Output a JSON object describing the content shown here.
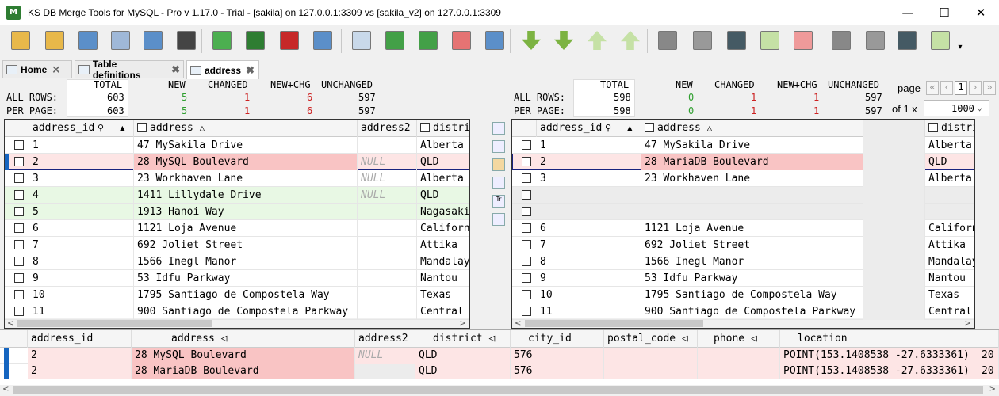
{
  "window": {
    "title": "KS DB Merge Tools for MySQL - Pro v 1.17.0 - Trial - [sakila] on 127.0.0.1:3309 vs [sakila_v2] on 127.0.0.1:3309",
    "minimize": "—",
    "maximize": "☐",
    "close": "✕"
  },
  "toolbar_icons": [
    "open-folder-icon",
    "open-folder-star-icon",
    "compare-tables-icon",
    "select-sql-icon",
    "table-settings-icon",
    "binoculars-icon",
    "refresh-icon",
    "export-excel-icon",
    "sql-script-icon",
    "copy-pages-icon",
    "grid-all-icon",
    "grid-green-icon",
    "grid-green2-icon",
    "grid-red-icon",
    "grid-blue-icon",
    "down-next-icon",
    "down-next2-icon",
    "up-prev-icon",
    "up-prev2-icon",
    "checklist-icon",
    "page-icon",
    "check-dark-icon",
    "merge-right-icon",
    "delete-right-icon",
    "checklist2-icon",
    "page2-icon",
    "check-dark2-icon",
    "merge-left-icon",
    "more-arrow-icon"
  ],
  "tabs": [
    {
      "label": "Home"
    },
    {
      "label": "Table definitions"
    },
    {
      "label": "address"
    }
  ],
  "stats": {
    "all_rows_label": "ALL ROWS:",
    "per_page_label": "PER PAGE:",
    "headers": {
      "total": "TOTAL",
      "new": "NEW",
      "changed": "CHANGED",
      "new_chg": "NEW+CHG",
      "unchanged": "UNCHANGED"
    },
    "left": {
      "all": {
        "total": "603",
        "new": "5",
        "changed": "1",
        "new_chg": "6",
        "unchanged": "597"
      },
      "page": {
        "total": "603",
        "new": "5",
        "changed": "1",
        "new_chg": "6",
        "unchanged": "597"
      }
    },
    "right": {
      "all": {
        "total": "598",
        "new": "0",
        "changed": "1",
        "new_chg": "1",
        "unchanged": "597"
      },
      "page": {
        "total": "598",
        "new": "0",
        "changed": "1",
        "new_chg": "1",
        "unchanged": "597"
      }
    },
    "colors": {
      "new": "#2e9e2e",
      "changed": "#cc2222"
    }
  },
  "paging": {
    "page_label": "page",
    "first": "«",
    "prev": "‹",
    "current": "1",
    "next": "›",
    "last": "»",
    "of_label": "of 1 x",
    "page_size": "1000",
    "dropdown": "⌄"
  },
  "left_grid": {
    "headers": {
      "id": "address_id",
      "address": "address",
      "address2": "address2",
      "district": "distric"
    },
    "sort_asc": "▲",
    "sort_hint": "△",
    "search_icon": "🔍",
    "rows": [
      {
        "id": "1",
        "address": "47 MySakila Drive",
        "address2": "",
        "district": "Alberta",
        "state": ""
      },
      {
        "id": "2",
        "address": "28 MySQL Boulevard",
        "address2": "NULL",
        "district": "QLD",
        "state": "red"
      },
      {
        "id": "3",
        "address": "23 Workhaven Lane",
        "address2": "NULL",
        "district": "Alberta",
        "state": ""
      },
      {
        "id": "4",
        "address": "1411 Lillydale Drive",
        "address2": "NULL",
        "district": "QLD",
        "state": "green"
      },
      {
        "id": "5",
        "address": "1913 Hanoi Way",
        "address2": "",
        "district": "Nagasaki",
        "state": "green"
      },
      {
        "id": "6",
        "address": "1121 Loja Avenue",
        "address2": "",
        "district": "Californ",
        "state": ""
      },
      {
        "id": "7",
        "address": "692 Joliet Street",
        "address2": "",
        "district": "Attika",
        "state": ""
      },
      {
        "id": "8",
        "address": "1566 Inegl Manor",
        "address2": "",
        "district": "Mandalay",
        "state": ""
      },
      {
        "id": "9",
        "address": "53 Idfu Parkway",
        "address2": "",
        "district": "Nantou",
        "state": ""
      },
      {
        "id": "10",
        "address": "1795 Santiago de Compostela Way",
        "address2": "",
        "district": "Texas",
        "state": ""
      },
      {
        "id": "11",
        "address": "900 Santiago de Compostela Parkway",
        "address2": "",
        "district": "Central",
        "state": ""
      }
    ]
  },
  "right_grid": {
    "headers": {
      "id": "address_id",
      "address": "address",
      "address2": "",
      "district": "distri"
    },
    "rows": [
      {
        "id": "1",
        "address": "47 MySakila Drive",
        "district": "Alberta",
        "state": ""
      },
      {
        "id": "2",
        "address": "28 MariaDB Boulevard",
        "district": "QLD",
        "state": "red"
      },
      {
        "id": "3",
        "address": "23 Workhaven Lane",
        "district": "Alberta",
        "state": ""
      },
      {
        "id": "",
        "address": "",
        "district": "",
        "state": "empty"
      },
      {
        "id": "",
        "address": "",
        "district": "",
        "state": "empty"
      },
      {
        "id": "6",
        "address": "1121 Loja Avenue",
        "district": "Californ",
        "state": ""
      },
      {
        "id": "7",
        "address": "692 Joliet Street",
        "district": "Attika",
        "state": ""
      },
      {
        "id": "8",
        "address": "1566 Inegl Manor",
        "district": "Mandalay",
        "state": ""
      },
      {
        "id": "9",
        "address": "53 Idfu Parkway",
        "district": "Nantou",
        "state": ""
      },
      {
        "id": "10",
        "address": "1795 Santiago de Compostela Way",
        "district": "Texas",
        "state": ""
      },
      {
        "id": "11",
        "address": "900 Santiago de Compostela Parkway",
        "district": "Central",
        "state": ""
      }
    ]
  },
  "detail_grid": {
    "headers": {
      "id": "address_id",
      "address": "address",
      "address2": "address2",
      "district": "district",
      "city_id": "city_id",
      "postal_code": "postal_code",
      "phone": "phone",
      "location": "location"
    },
    "rows": [
      {
        "id": "2",
        "address": "28 MySQL Boulevard",
        "address2": "NULL",
        "district": "QLD",
        "city_id": "576",
        "postal_code": "",
        "phone": "",
        "location": "POINT(153.1408538 -27.6333361)",
        "extra": "20"
      },
      {
        "id": "2",
        "address": "28 MariaDB Boulevard",
        "address2": "",
        "district": "QLD",
        "city_id": "576",
        "postal_code": "",
        "phone": "",
        "location": "POINT(153.1408538 -27.6333361)",
        "extra": "20"
      }
    ]
  }
}
